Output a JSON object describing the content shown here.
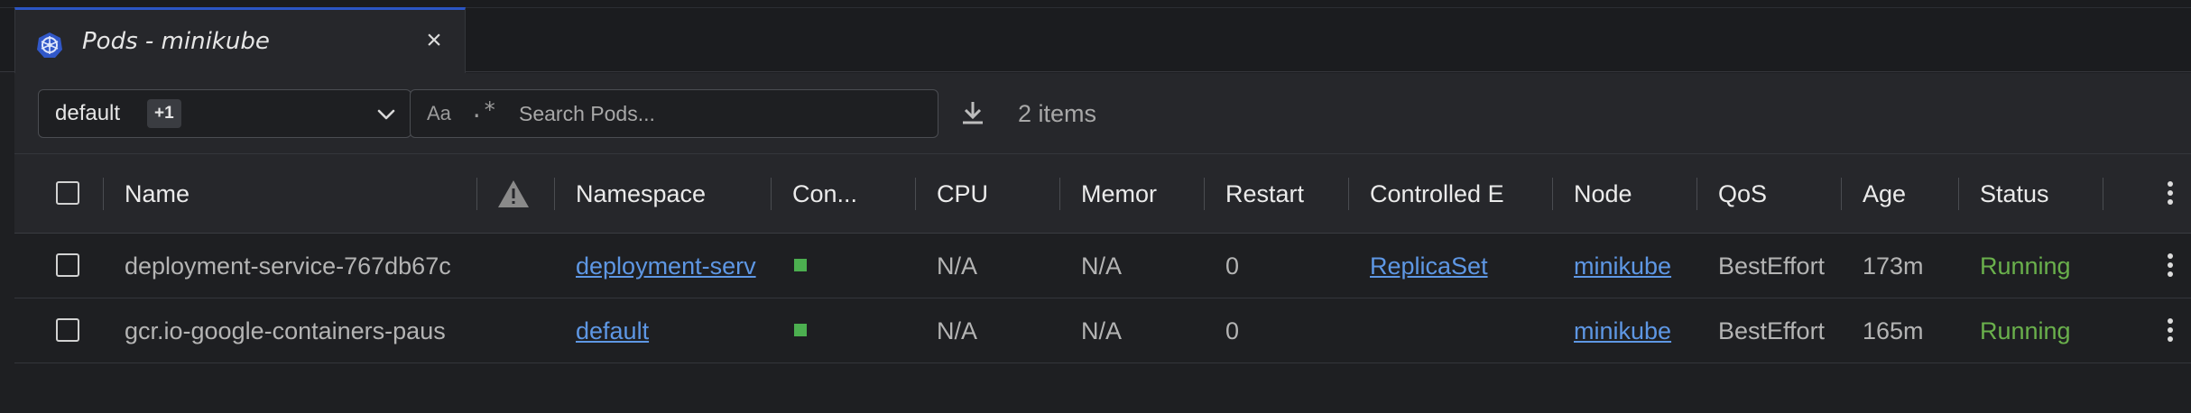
{
  "tab": {
    "title": "Pods - minikube",
    "close_glyph": "×",
    "icon": "kubernetes-icon"
  },
  "toolbar": {
    "namespace_value": "default",
    "namespace_badge": "+1",
    "search_aa": "Aa",
    "search_regex": ".*",
    "search_placeholder": "Search Pods...",
    "items_count": "2 items"
  },
  "table": {
    "columns": {
      "name": "Name",
      "warnings_icon": "warning-icon",
      "namespace": "Namespace",
      "containers": "Con...",
      "cpu": "CPU",
      "memory": "Memor",
      "restarts": "Restart",
      "controlled_by": "Controlled E",
      "node": "Node",
      "qos": "QoS",
      "age": "Age",
      "status": "Status"
    },
    "rows": [
      {
        "name": "deployment-service-767db67c",
        "namespace": "deployment-serv",
        "cpu": "N/A",
        "memory": "N/A",
        "restarts": "0",
        "controlled_by": "ReplicaSet",
        "node": "minikube",
        "qos": "BestEffort",
        "age": "173m",
        "status": "Running"
      },
      {
        "name": "gcr.io-google-containers-paus",
        "namespace": "default",
        "cpu": "N/A",
        "memory": "N/A",
        "restarts": "0",
        "controlled_by": "",
        "node": "minikube",
        "qos": "BestEffort",
        "age": "165m",
        "status": "Running"
      }
    ]
  },
  "colors": {
    "accent": "#2b55c4",
    "link": "#5e97e4",
    "running": "#6ab04c",
    "container_ready": "#4caf50"
  }
}
